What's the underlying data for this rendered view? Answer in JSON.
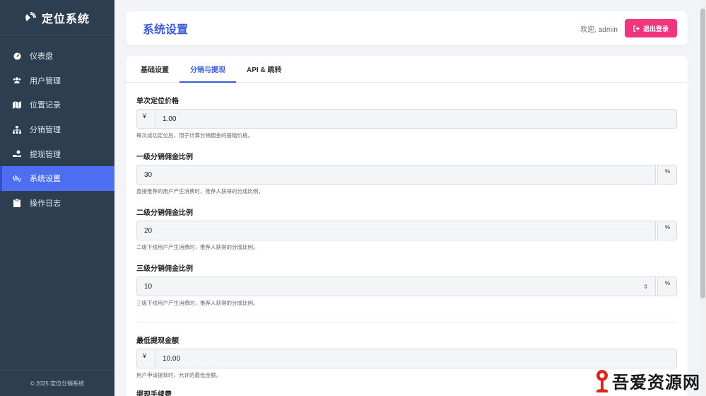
{
  "brand": {
    "title": "定位系统"
  },
  "sidebar": {
    "items": [
      {
        "label": "仪表盘",
        "icon": "dashboard-icon"
      },
      {
        "label": "用户管理",
        "icon": "users-icon"
      },
      {
        "label": "位置记录",
        "icon": "map-icon"
      },
      {
        "label": "分销管理",
        "icon": "sitemap-icon"
      },
      {
        "label": "提现管理",
        "icon": "hand-coin-icon"
      },
      {
        "label": "系统设置",
        "icon": "cogs-icon",
        "active": true
      },
      {
        "label": "操作日志",
        "icon": "clipboard-icon"
      }
    ],
    "footer": "© 2025 定位分销系统"
  },
  "header": {
    "title": "系统设置",
    "welcome": "欢迎, admin",
    "logout": "退出登录"
  },
  "tabs": [
    {
      "label": "基础设置"
    },
    {
      "label": "分销与提现",
      "active": true
    },
    {
      "label": "API & 跳转"
    }
  ],
  "form": {
    "price": {
      "label": "单次定位价格",
      "prefix": "¥",
      "value": "1.00",
      "help": "每次成功定位后，用于计算分销佣金的基础价格。"
    },
    "level1": {
      "label": "一级分销佣金比例",
      "value": "30",
      "suffix": "%",
      "help": "直接推荐的用户产生消费时，推荐人获得的分成比例。"
    },
    "level2": {
      "label": "二级分销佣金比例",
      "value": "20",
      "suffix": "%",
      "help": "二级下线用户产生消费时，推荐人获得的分成比例。"
    },
    "level3": {
      "label": "三级分销佣金比例",
      "value": "10",
      "suffix": "%",
      "spinner": "⇕",
      "help": "三级下线用户产生消费时，推荐人获得的分成比例。"
    },
    "min_withdraw": {
      "label": "最低提现金额",
      "prefix": "¥",
      "value": "10.00",
      "help": "用户申请提现时，允许的最低金额。"
    },
    "next_label": "提现手续费"
  },
  "watermark": {
    "text": "吾爱资源网"
  },
  "colors": {
    "sidebar": "#2c3e50",
    "accent": "#4e6ef2",
    "logout": "#f0347e"
  }
}
